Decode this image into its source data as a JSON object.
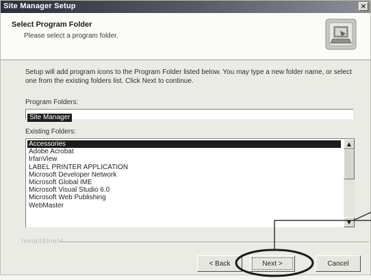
{
  "window": {
    "title": "Site Manager Setup",
    "close_glyph": "×"
  },
  "header": {
    "title": "Select Program Folder",
    "subtitle": "Please select a program folder.",
    "icon": "setup-computer-icon"
  },
  "body": {
    "instructions": "Setup will add program icons to the Program Folder listed below. You may type a new folder name, or select one from the existing folders list. Click Next to continue."
  },
  "program_folder": {
    "label": "Program Folders:",
    "value": "Site Manager"
  },
  "existing_folders": {
    "label": "Existing Folders:",
    "items": [
      "Accessories",
      "Adobe Acrobat",
      "IrfanView",
      "LABEL PRINTER APPLICATION",
      "Microsoft Developer Network",
      "Microsoft Global IME",
      "Microsoft Visual Studio 6.0",
      "Microsoft Web Publishing",
      "WebMaster"
    ],
    "selected_index": 0
  },
  "footer": {
    "brand": "InstallShield"
  },
  "buttons": {
    "back": "< Back",
    "next": "Next >",
    "cancel": "Cancel"
  },
  "colors": {
    "title_bar": "#2a2f3a",
    "selection": "#1c1c1c",
    "annotation": "#1a1a1a"
  }
}
